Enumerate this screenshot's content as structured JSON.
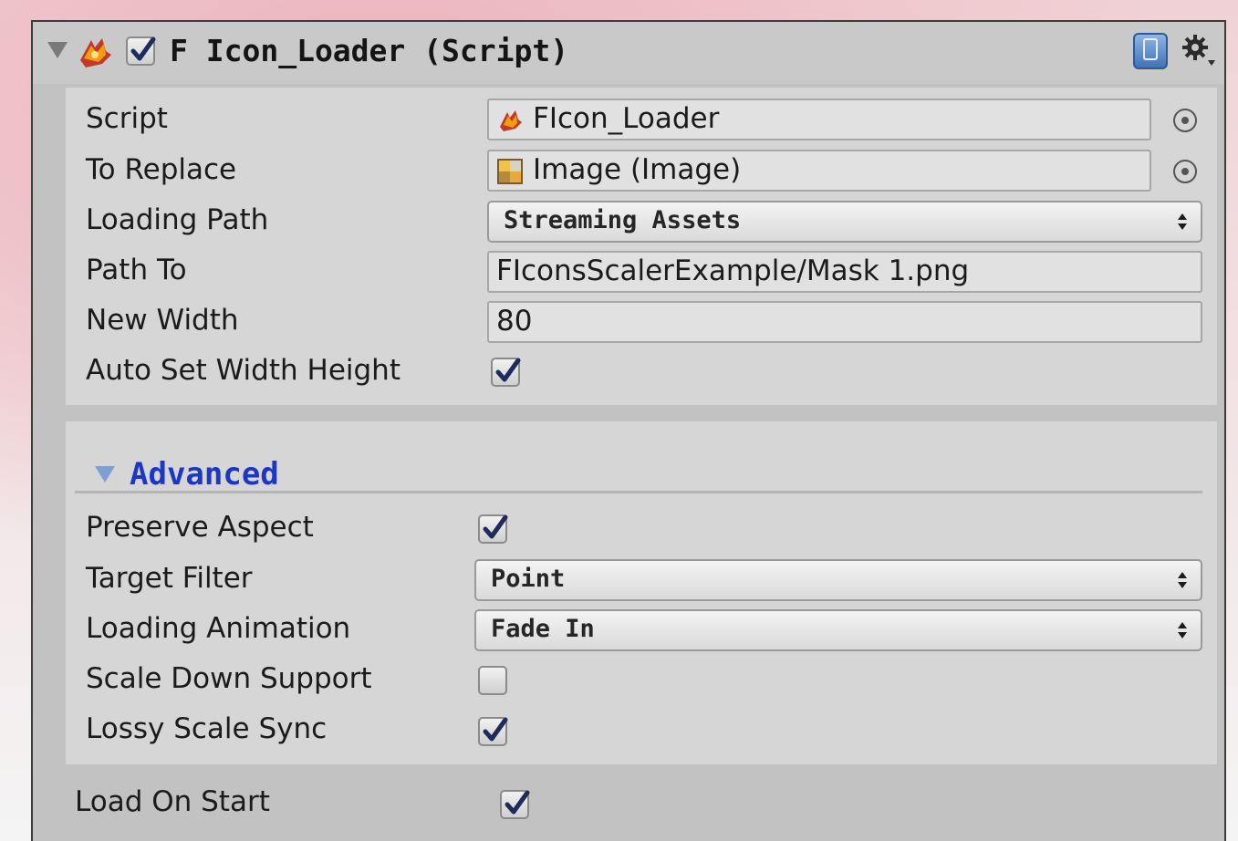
{
  "component": {
    "title": "F Icon_Loader (Script)",
    "enabled": true,
    "icons": [
      "foldout-arrow-icon",
      "script-icon",
      "help-icon",
      "gear-icon"
    ]
  },
  "fields": {
    "script": {
      "label": "Script",
      "value": "FIcon_Loader"
    },
    "to_replace": {
      "label": "To Replace",
      "value": "Image (Image)"
    },
    "loading_path": {
      "label": "Loading Path",
      "value": "Streaming Assets"
    },
    "path_to": {
      "label": "Path To",
      "value": "FIconsScalerExample/Mask 1.png"
    },
    "new_width": {
      "label": "New Width",
      "value": "80"
    },
    "auto_set_width_height": {
      "label": "Auto Set Width Height",
      "checked": true
    }
  },
  "advanced": {
    "label": "Advanced",
    "expanded": true,
    "preserve_aspect": {
      "label": "Preserve Aspect",
      "checked": true
    },
    "target_filter": {
      "label": "Target Filter",
      "value": "Point"
    },
    "loading_animation": {
      "label": "Loading Animation",
      "value": "Fade In"
    },
    "scale_down_support": {
      "label": "Scale Down Support",
      "checked": false
    },
    "lossy_scale_sync": {
      "label": "Lossy Scale Sync",
      "checked": true
    }
  },
  "load_on_start": {
    "label": "Load On Start",
    "checked": true
  },
  "colors": {
    "panel_bg": "#c2c2c2",
    "section_bg": "#d6d6d6",
    "foldout_label": "#1c36c8",
    "background_accent": "#e9b3ba"
  }
}
